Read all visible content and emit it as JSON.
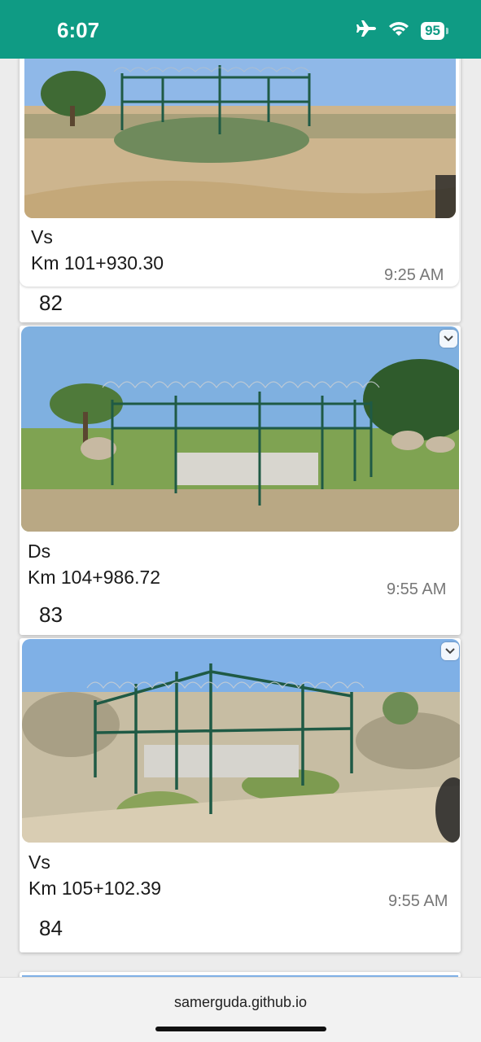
{
  "status_bar": {
    "time": "6:07",
    "battery": "95",
    "color": "#0f9b84"
  },
  "entries": [
    {
      "type": "Vs",
      "km": "Km 101+930.30",
      "time": "9:25 AM",
      "number": "82"
    },
    {
      "type": "Ds",
      "km": "Km 104+986.72",
      "time": "9:55 AM",
      "number": "83"
    },
    {
      "type": "Vs",
      "km": "Km 105+102.39",
      "time": "9:55 AM",
      "number": "84"
    }
  ],
  "browser": {
    "url": "samerguda.github.io"
  }
}
